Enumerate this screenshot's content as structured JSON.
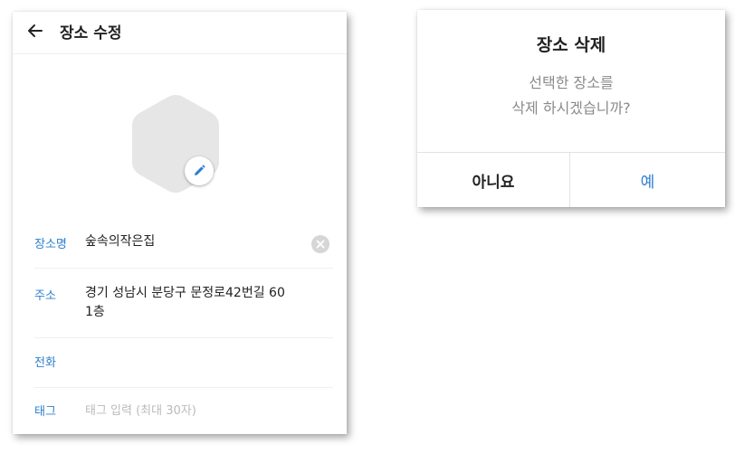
{
  "edit_screen": {
    "title": "장소 수정",
    "back_icon": "arrow-left-icon",
    "photo_placeholder_icon": "hexagon-placeholder-icon",
    "edit_photo_icon": "pencil-icon",
    "fields": {
      "name": {
        "label": "장소명",
        "value": "숲속의작은집"
      },
      "address": {
        "label": "주소",
        "value_line1": "경기 성남시 분당구 문정로42번길 60",
        "value_line2": "1층"
      },
      "phone": {
        "label": "전화",
        "value": ""
      },
      "tag": {
        "label": "태그",
        "placeholder": "태그 입력 (최대 30자)"
      }
    },
    "clear_icon": "clear-circle-icon"
  },
  "delete_dialog": {
    "title": "장소 삭제",
    "message_line1": "선택한 장소를",
    "message_line2": "삭제 하시겠습니까?",
    "no_label": "아니요",
    "yes_label": "예"
  },
  "colors": {
    "accent": "#2c7fcf",
    "text": "#222222",
    "muted": "#8a8a8a",
    "placeholder": "#bbbbbb",
    "hexagon": "#e6e6e6"
  }
}
